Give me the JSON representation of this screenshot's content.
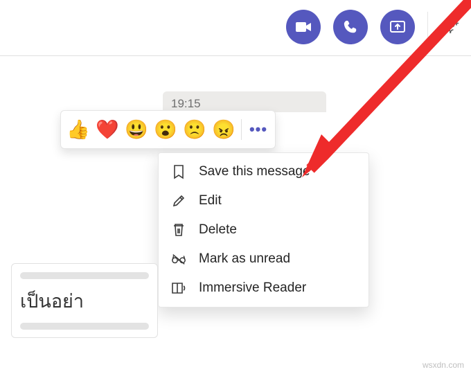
{
  "header": {
    "video_btn": "video-call",
    "audio_btn": "audio-call",
    "share_btn": "share-screen",
    "add_people": "add-people"
  },
  "message": {
    "timestamp": "19:15"
  },
  "reactions": {
    "items": [
      {
        "name": "like",
        "emoji": "👍"
      },
      {
        "name": "heart",
        "emoji": "❤️"
      },
      {
        "name": "laugh",
        "emoji": "😃"
      },
      {
        "name": "surprised",
        "emoji": "😮"
      },
      {
        "name": "sad",
        "emoji": "🙁"
      },
      {
        "name": "angry",
        "emoji": "😠"
      }
    ],
    "more": "•••"
  },
  "menu": {
    "items": [
      {
        "id": "save",
        "label": "Save this message",
        "icon": "bookmark"
      },
      {
        "id": "edit",
        "label": "Edit",
        "icon": "pencil"
      },
      {
        "id": "delete",
        "label": "Delete",
        "icon": "trash"
      },
      {
        "id": "unread",
        "label": "Mark as unread",
        "icon": "glasses-off"
      },
      {
        "id": "immersive",
        "label": "Immersive Reader",
        "icon": "book-speaker"
      }
    ]
  },
  "compose": {
    "text": "เป็นอย่า"
  },
  "colors": {
    "accent": "#5558be",
    "arrow": "#ee2b2b"
  },
  "watermark": "wsxdn.com"
}
